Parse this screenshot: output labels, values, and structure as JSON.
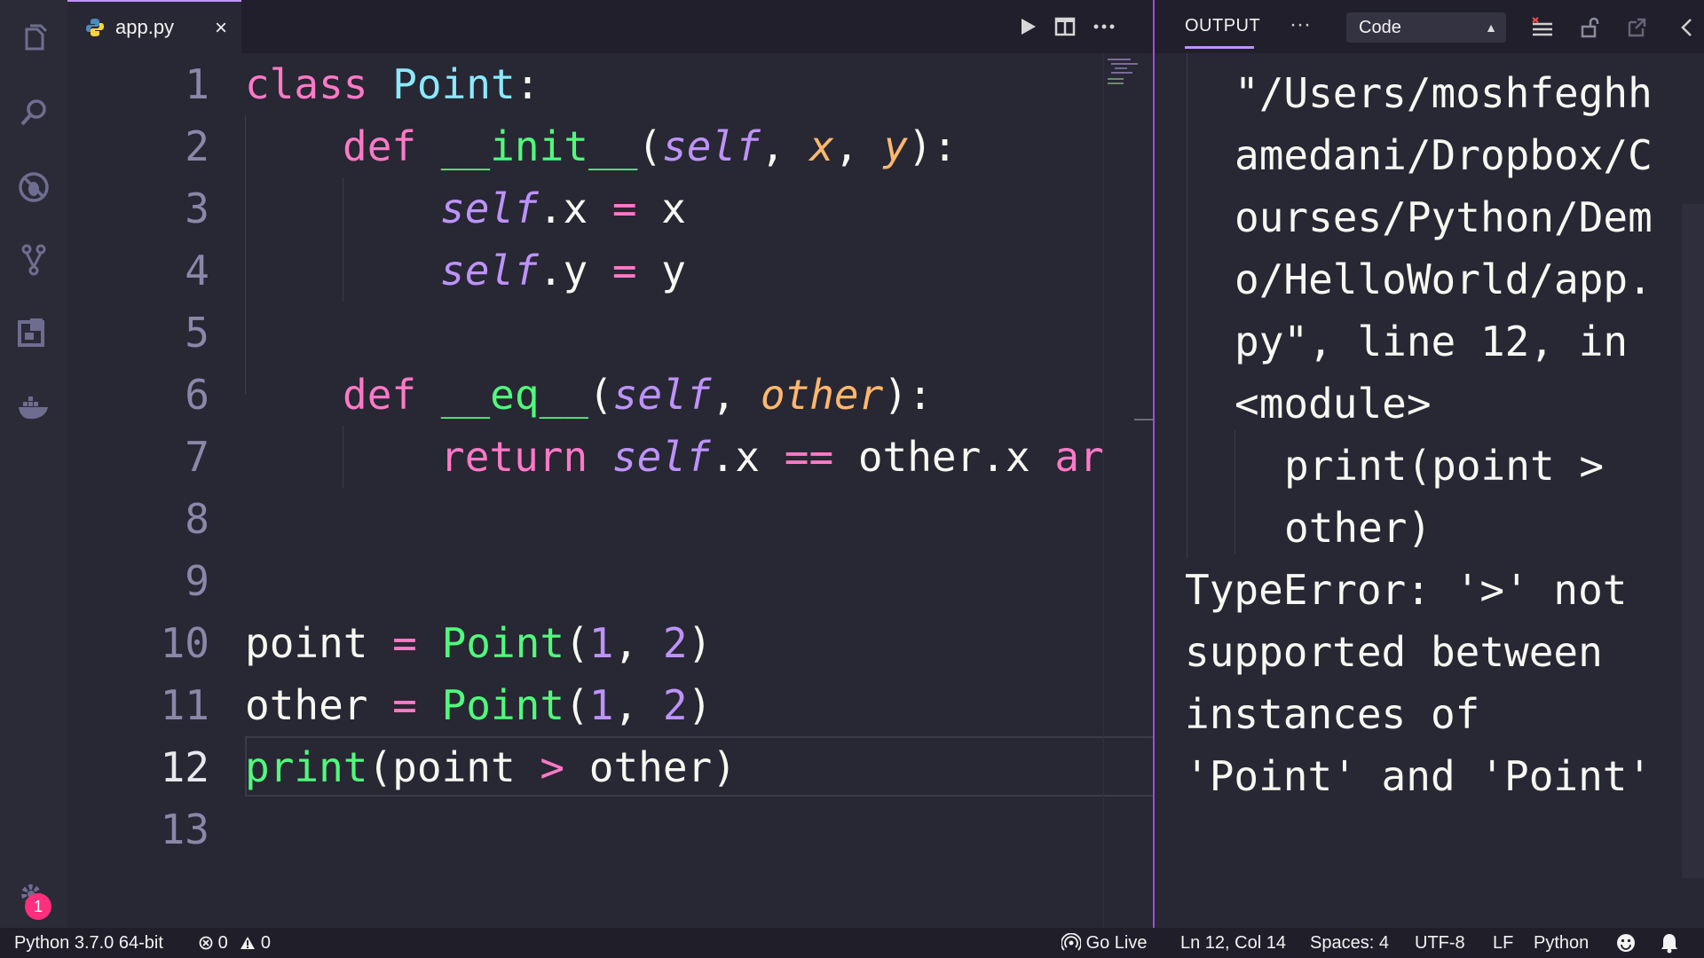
{
  "tab": {
    "filename": "app.py",
    "close": "×"
  },
  "editor": {
    "line_numbers": [
      "1",
      "2",
      "3",
      "4",
      "5",
      "6",
      "7",
      "8",
      "9",
      "10",
      "11",
      "12",
      "13"
    ],
    "code": {
      "l1": [
        "class",
        " ",
        "Point",
        ":"
      ],
      "l2": [
        "def",
        " ",
        "__init__",
        "(",
        "self",
        ", ",
        "x",
        ", ",
        "y",
        "):"
      ],
      "l3": [
        "self",
        ".x ",
        "=",
        " x"
      ],
      "l4": [
        "self",
        ".y ",
        "=",
        " y"
      ],
      "l6": [
        "def",
        " ",
        "__eq__",
        "(",
        "self",
        ", ",
        "other",
        "):"
      ],
      "l7": [
        "return",
        " ",
        "self",
        ".x ",
        "==",
        " other.x ",
        "ar"
      ],
      "l10": [
        "point ",
        "=",
        " ",
        "Point",
        "(",
        "1",
        ", ",
        "2",
        ")"
      ],
      "l11": [
        "other ",
        "=",
        " ",
        "Point",
        "(",
        "1",
        ", ",
        "2",
        ")"
      ],
      "l12": [
        "print",
        "(point ",
        ">",
        " other)"
      ]
    }
  },
  "output": {
    "title": "OUTPUT",
    "more": "···",
    "channel": "Code",
    "lines": [
      "\"/Users/moshfeghh",
      "amedani/Dropbox/C",
      "ourses/Python/Dem",
      "o/HelloWorld/app.",
      "py\", line 12, in",
      "<module>",
      "print(point >",
      "other)",
      "TypeError: '>' not",
      "supported between",
      "instances of",
      "'Point' and 'Point'"
    ]
  },
  "status": {
    "interpreter": "Python 3.7.0 64-bit",
    "errors": "0",
    "warnings": "0",
    "golive": "Go Live",
    "position": "Ln 12, Col 14",
    "spaces": "Spaces: 4",
    "encoding": "UTF-8",
    "eol": "LF",
    "language": "Python"
  },
  "activity": {
    "badge": "1"
  },
  "colors": {
    "keyword": "#ff79c6",
    "class": "#8be9fd",
    "function": "#50fa7b",
    "self": "#bd93f9",
    "param": "#ffb86c",
    "accent": "#bd93f9",
    "badge": "#ff2f7d"
  },
  "icons": [
    "files-icon",
    "search-icon",
    "debug-icon",
    "source-control-icon",
    "extensions-icon",
    "docker-icon",
    "gear-icon",
    "python-file-icon",
    "run-icon",
    "split-editor-icon",
    "more-icon",
    "clear-output-icon",
    "lock-icon",
    "open-log-icon",
    "chevron-left-icon",
    "error-icon",
    "warning-icon",
    "broadcast-icon",
    "smiley-icon",
    "bell-icon"
  ]
}
